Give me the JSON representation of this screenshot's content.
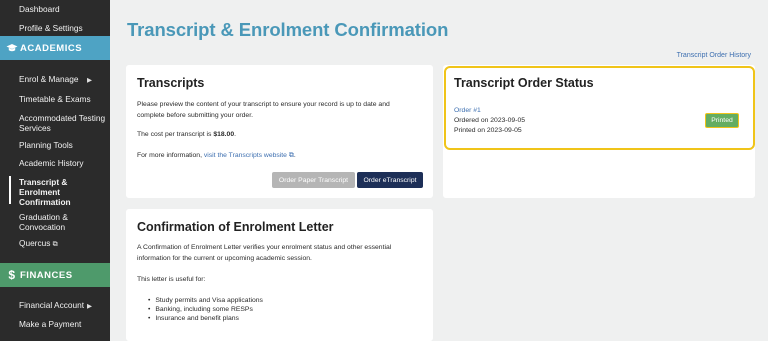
{
  "sidebar": {
    "items_top": [
      {
        "label": "Dashboard"
      },
      {
        "label": "Profile & Settings"
      }
    ],
    "academics": {
      "heading": "ACADEMICS",
      "icon": "graduation-cap-icon",
      "items": [
        {
          "label": "Enrol & Manage",
          "chevron": "▶"
        },
        {
          "label": "Timetable & Exams"
        },
        {
          "label": "Accommodated Testing Services"
        },
        {
          "label": "Planning Tools"
        },
        {
          "label": "Academic History"
        },
        {
          "label": "Transcript & Enrolment Confirmation"
        },
        {
          "label": "Graduation & Convocation"
        },
        {
          "label": "Quercus",
          "ext": "⧉"
        }
      ]
    },
    "finances": {
      "heading": "FINANCES",
      "icon": "dollar-icon",
      "icon_glyph": "$",
      "items": [
        {
          "label": "Financial Account",
          "chevron": "▶"
        },
        {
          "label": "Make a Payment"
        }
      ]
    }
  },
  "main": {
    "title": "Transcript & Enrolment Confirmation",
    "history_link": "Transcript Order History",
    "transcripts": {
      "title": "Transcripts",
      "p1": "Please preview the content of your transcript to ensure your record is up to date and complete before submitting your order.",
      "cost_prefix": "The cost per transcript is ",
      "cost": "$18.00",
      "cost_suffix": ".",
      "info_prefix": "For more information, ",
      "info_link": "visit the Transcripts website",
      "info_ext": "⧉",
      "info_suffix": ".",
      "btn_paper": "Order Paper Transcript",
      "btn_etranscript": "Order eTranscript"
    },
    "status": {
      "title": "Transcript Order Status",
      "order_link": "Order #1",
      "ordered": "Ordered on 2023-09-05",
      "printed": "Printed on 2023-09-05",
      "badge": "Printed"
    },
    "confirmation": {
      "title": "Confirmation of Enrolment Letter",
      "p1": "A Confirmation of Enrolment Letter verifies your enrolment status and other essential information for the current or upcoming academic session.",
      "p2": "This letter is useful for:",
      "bullets": [
        "Study permits and Visa applications",
        "Banking, including some RESPs",
        "Insurance and benefit plans"
      ]
    }
  },
  "colors": {
    "sidebar_bg": "#2b2b2b",
    "academics": "#4ea3c4",
    "finances": "#4e9a6b",
    "title": "#4a98b8",
    "highlight": "#f0c419",
    "badge": "#64ad62",
    "primary_button": "#1d2f57"
  }
}
